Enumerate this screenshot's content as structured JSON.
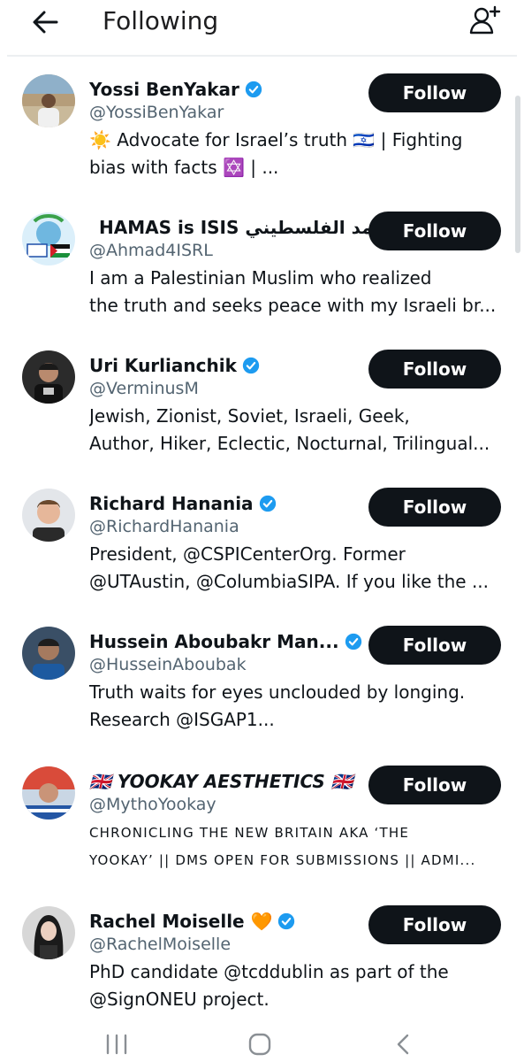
{
  "header": {
    "title": "Following",
    "back_icon": "arrow-left-icon",
    "add_icon": "add-user-icon"
  },
  "colors": {
    "follow_bg": "#0f1419",
    "verified": "#1d9bf0",
    "handle": "#536471",
    "heart": "#f7931e"
  },
  "users": [
    {
      "name": "Yossi BenYakar",
      "verified": true,
      "handle": "@YossiBenYakar",
      "bio_lines": [
        "☀️ Advocate for Israel’s truth 🇮🇱 | Fighting",
        "bias with facts ✡️ |  ..."
      ],
      "follow_label": "Follow"
    },
    {
      "name": "HAMAS is ISIS أحمد الفلسطيني",
      "verified": false,
      "handle": "@Ahmad4ISRL",
      "bio_lines": [
        "I am a Palestinian Muslim who realized",
        "the truth and seeks peace with my Israeli br..."
      ],
      "follow_label": "Follow"
    },
    {
      "name": "Uri Kurlianchik",
      "verified": true,
      "handle": "@VerminusM",
      "bio_lines": [
        "Jewish, Zionist, Soviet, Israeli, Geek,",
        "Author, Hiker, Eclectic, Nocturnal, Trilingual..."
      ],
      "follow_label": "Follow"
    },
    {
      "name": "Richard Hanania",
      "verified": true,
      "handle": "@RichardHanania",
      "bio_lines": [
        "President, @CSPICenterOrg. Former",
        "@UTAustin, @ColumbiaSIPA. If you like the ..."
      ],
      "follow_label": "Follow"
    },
    {
      "name": "Hussein Aboubakr Man...",
      "verified": true,
      "handle": "@HusseinAboubak",
      "bio_lines": [
        "Truth waits for eyes unclouded by longing.",
        "Research @ISGAP1..."
      ],
      "follow_label": "Follow"
    },
    {
      "name": "🇬🇧 YOOKAY AESTHETICS 🇬🇧",
      "verified": false,
      "handle": "@MythoYookay",
      "bio_lines": [
        "CHRONICLING THE NEW BRITAIN AKA ‘THE",
        "YOOKAY’ || DMS OPEN FOR SUBMISSIONS  || ADMI..."
      ],
      "follow_label": "Follow"
    },
    {
      "name": "Rachel Moiselle 🧡",
      "verified": true,
      "handle": "@RachelMoiselle",
      "bio_lines": [
        "PhD candidate @tcddublin as part of the",
        "@SignONEU project."
      ],
      "follow_label": "Follow"
    }
  ],
  "navbar": {
    "recents_icon": "recent-apps-icon",
    "home_icon": "home-icon",
    "back_icon": "nav-back-icon"
  }
}
